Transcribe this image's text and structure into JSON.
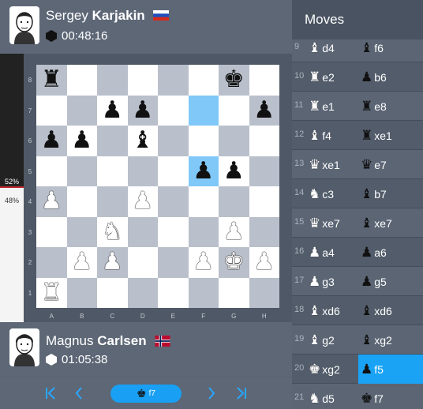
{
  "top_player": {
    "first_name": "Sergey",
    "last_name": "Karjakin",
    "flag": "russia-flag",
    "clock": "00:48:16",
    "clock_icon": "black-hexagon-icon"
  },
  "bottom_player": {
    "first_name": "Magnus",
    "last_name": "Carlsen",
    "flag": "norway-flag",
    "clock": "01:05:38",
    "clock_icon": "white-hexagon-icon"
  },
  "eval": {
    "black_pct_label": "52%",
    "white_pct_label": "48%",
    "black_fraction": 0.52
  },
  "board": {
    "files": [
      "A",
      "B",
      "C",
      "D",
      "E",
      "F",
      "G",
      "H"
    ],
    "ranks": [
      "8",
      "7",
      "6",
      "5",
      "4",
      "3",
      "2",
      "1"
    ],
    "position": [
      [
        "br",
        "",
        "",
        "",
        "",
        "",
        "bk",
        ""
      ],
      [
        "",
        "",
        "bp",
        "bp",
        "",
        "",
        "",
        "bp"
      ],
      [
        "bp",
        "bp",
        "",
        "bb",
        "",
        "",
        "",
        ""
      ],
      [
        "",
        "",
        "",
        "",
        "",
        "bp",
        "bp",
        ""
      ],
      [
        "wp",
        "",
        "",
        "wp",
        "",
        "",
        "",
        ""
      ],
      [
        "",
        "",
        "wn",
        "",
        "",
        "",
        "wp",
        ""
      ],
      [
        "",
        "wp",
        "wp",
        "",
        "",
        "wp",
        "wk",
        "wp"
      ],
      [
        "wr",
        "",
        "",
        "",
        "",
        "",
        "",
        ""
      ]
    ],
    "highlighted_squares": [
      "f7",
      "f5"
    ]
  },
  "nav": {
    "first_icon": "first-move-icon",
    "prev_icon": "prev-move-icon",
    "next_icon": "next-move-icon",
    "last_icon": "last-move-icon",
    "current_move_piece": "bk",
    "current_move_label": "f7"
  },
  "moves_panel": {
    "title": "Moves",
    "rows": [
      {
        "no": "9",
        "w_piece": "wb",
        "w": "d4",
        "b_piece": "bb",
        "b": "f6"
      },
      {
        "no": "10",
        "w_piece": "wr",
        "w": "e2",
        "b_piece": "bp",
        "b": "b6"
      },
      {
        "no": "11",
        "w_piece": "wr",
        "w": "e1",
        "b_piece": "br",
        "b": "e8"
      },
      {
        "no": "12",
        "w_piece": "wb",
        "w": "f4",
        "b_piece": "br",
        "b": "xe1"
      },
      {
        "no": "13",
        "w_piece": "wq",
        "w": "xe1",
        "b_piece": "bq",
        "b": "e7"
      },
      {
        "no": "14",
        "w_piece": "wn",
        "w": "c3",
        "b_piece": "bb",
        "b": "b7"
      },
      {
        "no": "15",
        "w_piece": "wq",
        "w": "xe7",
        "b_piece": "bb",
        "b": "xe7"
      },
      {
        "no": "16",
        "w_piece": "wp",
        "w": "a4",
        "b_piece": "bp",
        "b": "a6"
      },
      {
        "no": "17",
        "w_piece": "wp",
        "w": "g3",
        "b_piece": "bp",
        "b": "g5"
      },
      {
        "no": "18",
        "w_piece": "wb",
        "w": "xd6",
        "b_piece": "bb",
        "b": "xd6"
      },
      {
        "no": "19",
        "w_piece": "wb",
        "w": "g2",
        "b_piece": "bb",
        "b": "xg2"
      },
      {
        "no": "20",
        "w_piece": "wk",
        "w": "xg2",
        "b_piece": "bp",
        "b": "f5"
      },
      {
        "no": "21",
        "w_piece": "wn",
        "w": "d5",
        "b_piece": "bk",
        "b": "f7"
      }
    ],
    "active": {
      "row": 11,
      "side": "b"
    }
  }
}
